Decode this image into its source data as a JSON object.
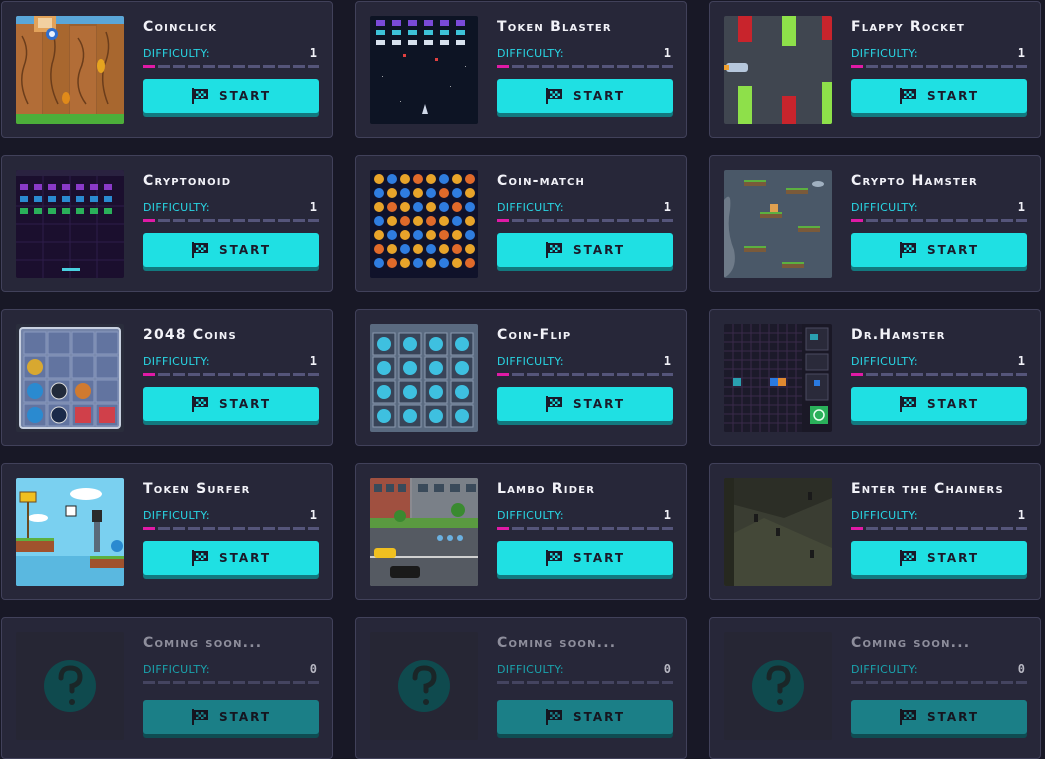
{
  "difficulty_label": "DIFFICULTY:",
  "start_label": "START",
  "colors": {
    "accent_cyan": "#1fe0e3",
    "difficulty_fill": "#e01aa6",
    "card_bg": "#272739",
    "page_bg": "#181826"
  },
  "games": [
    {
      "title": "Coinclick",
      "difficulty": "1",
      "difficulty_level": 0.07,
      "thumbnail": "fence-coins"
    },
    {
      "title": "Token Blaster",
      "difficulty": "1",
      "difficulty_level": 0.07,
      "thumbnail": "space-invaders"
    },
    {
      "title": "Flappy Rocket",
      "difficulty": "1",
      "difficulty_level": 0.07,
      "thumbnail": "pipes-rocket"
    },
    {
      "title": "Cryptonoid",
      "difficulty": "1",
      "difficulty_level": 0.07,
      "thumbnail": "breakout"
    },
    {
      "title": "Coin-match",
      "difficulty": "1",
      "difficulty_level": 0.07,
      "thumbnail": "match-three"
    },
    {
      "title": "Crypto Hamster",
      "difficulty": "1",
      "difficulty_level": 0.07,
      "thumbnail": "platform-jumper"
    },
    {
      "title": "2048 Coins",
      "difficulty": "1",
      "difficulty_level": 0.07,
      "thumbnail": "tile-grid"
    },
    {
      "title": "Coin-Flip",
      "difficulty": "1",
      "difficulty_level": 0.07,
      "thumbnail": "coin-grid"
    },
    {
      "title": "Dr.Hamster",
      "difficulty": "1",
      "difficulty_level": 0.07,
      "thumbnail": "pill-puzzle"
    },
    {
      "title": "Token Surfer",
      "difficulty": "1",
      "difficulty_level": 0.07,
      "thumbnail": "sky-runner"
    },
    {
      "title": "Lambo Rider",
      "difficulty": "1",
      "difficulty_level": 0.07,
      "thumbnail": "city-street"
    },
    {
      "title": "Enter the Chainers",
      "difficulty": "1",
      "difficulty_level": 0.07,
      "thumbnail": "dark-arena"
    },
    {
      "title": "Coming soon...",
      "difficulty": "0",
      "difficulty_level": 0,
      "thumbnail": "question-icon"
    },
    {
      "title": "Coming soon...",
      "difficulty": "0",
      "difficulty_level": 0,
      "thumbnail": "question-icon"
    },
    {
      "title": "Coming soon...",
      "difficulty": "0",
      "difficulty_level": 0,
      "thumbnail": "question-icon"
    }
  ]
}
